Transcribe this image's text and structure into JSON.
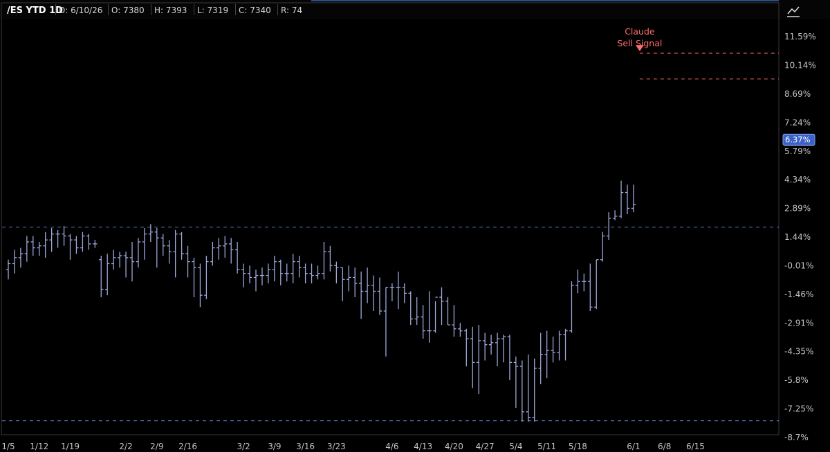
{
  "header": {
    "title": "/ES YTD 1D",
    "date": "D: 6/10/26",
    "open": "O: 7380",
    "high": "H: 7393",
    "low": "L: 7319",
    "close": "C: 7340",
    "range": "R: 74"
  },
  "toolbar": {
    "tool_icon": "drawing-tool-icon"
  },
  "colors": {
    "background": "#000000",
    "bar": "#9fa8da",
    "support_line": "#5b7fc4",
    "signal": "#ff6b6b",
    "last_price_badge": "#3b62c9",
    "border": "#3a3a3a"
  },
  "chart_data": {
    "type": "ohlc",
    "y_axis_unit": "%",
    "ylim": [
      -8.7,
      13.0
    ],
    "y_ticks": [
      "11.59%",
      "10.14%",
      "8.69%",
      "7.24%",
      "5.79%",
      "4.34%",
      "2.89%",
      "1.44%",
      "-0.01%",
      "-1.46%",
      "-2.91%",
      "-4.35%",
      "-5.8%",
      "-7.25%",
      "-8.7%"
    ],
    "y_tick_values": [
      11.59,
      10.14,
      8.69,
      7.24,
      5.79,
      4.34,
      2.89,
      1.44,
      -0.01,
      -1.46,
      -2.91,
      -4.35,
      -5.8,
      -7.25,
      -8.7
    ],
    "x_ticks": [
      "1/5",
      "1/12",
      "1/19",
      "2/2",
      "2/9",
      "2/16",
      "3/2",
      "3/9",
      "3/16",
      "3/23",
      "4/6",
      "4/13",
      "4/20",
      "4/27",
      "5/4",
      "5/11",
      "5/18",
      "6/1",
      "6/8",
      "6/15"
    ],
    "x_tick_index": [
      0,
      5,
      10,
      19,
      24,
      29,
      38,
      43,
      48,
      53,
      62,
      67,
      72,
      77,
      82,
      87,
      92,
      101,
      106,
      111
    ],
    "last_price_label": "6.37%",
    "last_price_value": 6.37,
    "horizontal_levels": [
      {
        "value": 1.95,
        "style": "dashed",
        "color": "#5b7fc4",
        "span": "full"
      },
      {
        "value": -7.85,
        "style": "dashed",
        "color": "#5b7fc4",
        "span": "full"
      },
      {
        "value": 10.75,
        "style": "dashed",
        "color": "#ff6b6b",
        "span": "from-signal"
      },
      {
        "value": 9.45,
        "style": "dashed",
        "color": "#ff6b6b",
        "span": "from-signal"
      }
    ],
    "annotation": {
      "text_line1": "Claude",
      "text_line2": "Sell Signal",
      "bar_index": 102,
      "value": 10.85
    },
    "bars": [
      {
        "o": -0.2,
        "h": 0.3,
        "l": -0.7,
        "c": 0.1
      },
      {
        "o": 0.1,
        "h": 0.8,
        "l": -0.4,
        "c": 0.4
      },
      {
        "o": 0.4,
        "h": 0.9,
        "l": -0.1,
        "c": 0.6
      },
      {
        "o": 0.6,
        "h": 1.5,
        "l": 0.2,
        "c": 1.2
      },
      {
        "o": 1.2,
        "h": 1.5,
        "l": 0.5,
        "c": 0.9
      },
      {
        "o": 0.9,
        "h": 1.2,
        "l": 0.5,
        "c": 1.0
      },
      {
        "o": 1.0,
        "h": 1.7,
        "l": 0.4,
        "c": 1.3
      },
      {
        "o": 1.3,
        "h": 1.9,
        "l": 0.7,
        "c": 1.6
      },
      {
        "o": 1.6,
        "h": 1.8,
        "l": 0.9,
        "c": 1.6
      },
      {
        "o": 1.6,
        "h": 2.0,
        "l": 1.0,
        "c": 1.5
      },
      {
        "o": 1.5,
        "h": 1.6,
        "l": 0.3,
        "c": 1.3
      },
      {
        "o": 1.3,
        "h": 1.5,
        "l": 0.6,
        "c": 0.9
      },
      {
        "o": 0.9,
        "h": 1.7,
        "l": 0.7,
        "c": 1.5
      },
      {
        "o": 1.5,
        "h": 1.6,
        "l": 0.8,
        "c": 1.1
      },
      {
        "o": 1.1,
        "h": 1.3,
        "l": 0.9,
        "c": 1.1
      },
      {
        "o": 0.3,
        "h": 0.5,
        "l": -1.6,
        "c": -1.2
      },
      {
        "o": -1.2,
        "h": 0.6,
        "l": -1.5,
        "c": 0.1
      },
      {
        "o": 0.1,
        "h": 0.8,
        "l": -0.2,
        "c": 0.4
      },
      {
        "o": 0.4,
        "h": 0.7,
        "l": -0.1,
        "c": 0.5
      },
      {
        "o": 0.5,
        "h": 0.7,
        "l": -0.6,
        "c": 0.4
      },
      {
        "o": 0.4,
        "h": 1.2,
        "l": -0.8,
        "c": 0.2
      },
      {
        "o": 0.2,
        "h": 1.4,
        "l": -0.1,
        "c": 1.2
      },
      {
        "o": 1.2,
        "h": 1.9,
        "l": 0.3,
        "c": 1.6
      },
      {
        "o": 1.6,
        "h": 2.1,
        "l": 1.2,
        "c": 1.7
      },
      {
        "o": 1.7,
        "h": 1.9,
        "l": -0.1,
        "c": 1.4
      },
      {
        "o": 1.4,
        "h": 1.6,
        "l": 0.5,
        "c": 1.0
      },
      {
        "o": 1.0,
        "h": 1.3,
        "l": 0.1,
        "c": 0.7
      },
      {
        "o": 0.7,
        "h": 1.8,
        "l": -0.6,
        "c": 1.6
      },
      {
        "o": 1.6,
        "h": 1.7,
        "l": 0.3,
        "c": 0.6
      },
      {
        "o": 0.6,
        "h": 1.0,
        "l": -0.6,
        "c": 0.2
      },
      {
        "o": 0.2,
        "h": 0.4,
        "l": -1.6,
        "c": -0.1
      },
      {
        "o": -0.1,
        "h": 0.1,
        "l": -2.1,
        "c": -1.5
      },
      {
        "o": -1.5,
        "h": 0.5,
        "l": -1.7,
        "c": 0.2
      },
      {
        "o": 0.2,
        "h": 1.2,
        "l": 0.0,
        "c": 0.9
      },
      {
        "o": 0.9,
        "h": 1.4,
        "l": 0.3,
        "c": 1.0
      },
      {
        "o": 1.0,
        "h": 1.5,
        "l": 0.4,
        "c": 1.1
      },
      {
        "o": 1.1,
        "h": 1.4,
        "l": 0.1,
        "c": 0.8
      },
      {
        "o": 0.8,
        "h": 1.2,
        "l": -0.4,
        "c": -0.2
      },
      {
        "o": -0.2,
        "h": 0.1,
        "l": -1.1,
        "c": -0.4
      },
      {
        "o": -0.4,
        "h": 0.0,
        "l": -0.9,
        "c": -0.6
      },
      {
        "o": -0.6,
        "h": -0.2,
        "l": -1.3,
        "c": -0.5
      },
      {
        "o": -0.5,
        "h": -0.1,
        "l": -1.0,
        "c": -0.5
      },
      {
        "o": -0.5,
        "h": 0.1,
        "l": -0.9,
        "c": -0.2
      },
      {
        "o": -0.2,
        "h": 0.5,
        "l": -0.8,
        "c": 0.2
      },
      {
        "o": 0.2,
        "h": 0.3,
        "l": -1.0,
        "c": -0.4
      },
      {
        "o": -0.4,
        "h": 0.1,
        "l": -0.8,
        "c": -0.4
      },
      {
        "o": -0.4,
        "h": 0.6,
        "l": -0.9,
        "c": 0.2
      },
      {
        "o": 0.2,
        "h": 0.5,
        "l": -0.6,
        "c": -0.1
      },
      {
        "o": -0.1,
        "h": 0.1,
        "l": -0.9,
        "c": -0.4
      },
      {
        "o": -0.4,
        "h": 0.1,
        "l": -0.9,
        "c": -0.5
      },
      {
        "o": -0.5,
        "h": 0.0,
        "l": -0.7,
        "c": -0.4
      },
      {
        "o": -0.4,
        "h": 1.2,
        "l": -0.7,
        "c": 0.7
      },
      {
        "o": 0.7,
        "h": 1.0,
        "l": -0.3,
        "c": 0.0
      },
      {
        "o": 0.0,
        "h": 0.2,
        "l": -0.9,
        "c": -0.1
      },
      {
        "o": -0.1,
        "h": -0.1,
        "l": -1.8,
        "c": -0.7
      },
      {
        "o": -0.7,
        "h": 0.0,
        "l": -1.3,
        "c": -0.6
      },
      {
        "o": -0.6,
        "h": -0.1,
        "l": -1.6,
        "c": -0.9
      },
      {
        "o": -0.9,
        "h": -0.3,
        "l": -2.7,
        "c": -1.3
      },
      {
        "o": -1.3,
        "h": -0.1,
        "l": -1.9,
        "c": -1.0
      },
      {
        "o": -1.0,
        "h": -0.5,
        "l": -2.3,
        "c": -1.3
      },
      {
        "o": -1.3,
        "h": -0.6,
        "l": -2.5,
        "c": -2.3
      },
      {
        "o": -2.3,
        "h": -1.1,
        "l": -4.6,
        "c": -1.1
      },
      {
        "o": -1.1,
        "h": -0.9,
        "l": -1.8,
        "c": -1.1
      },
      {
        "o": -1.1,
        "h": -0.3,
        "l": -2.2,
        "c": -1.1
      },
      {
        "o": -1.1,
        "h": -0.9,
        "l": -1.9,
        "c": -1.4
      },
      {
        "o": -1.4,
        "h": -1.3,
        "l": -3.0,
        "c": -2.7
      },
      {
        "o": -2.7,
        "h": -1.6,
        "l": -3.0,
        "c": -2.6
      },
      {
        "o": -2.6,
        "h": -2.0,
        "l": -3.7,
        "c": -3.3
      },
      {
        "o": -3.3,
        "h": -1.3,
        "l": -3.9,
        "c": -3.3
      },
      {
        "o": -3.3,
        "h": -1.8,
        "l": -3.4,
        "c": -1.6
      },
      {
        "o": -1.6,
        "h": -1.1,
        "l": -3.0,
        "c": -1.8
      },
      {
        "o": -1.8,
        "h": -1.6,
        "l": -3.0,
        "c": -3.0
      },
      {
        "o": -3.0,
        "h": -2.0,
        "l": -3.6,
        "c": -3.2
      },
      {
        "o": -3.2,
        "h": -2.9,
        "l": -3.6,
        "c": -3.3
      },
      {
        "o": -3.3,
        "h": -3.2,
        "l": -5.1,
        "c": -3.7
      },
      {
        "o": -3.7,
        "h": -3.1,
        "l": -6.2,
        "c": -4.9
      },
      {
        "o": -4.9,
        "h": -3.0,
        "l": -6.5,
        "c": -3.8
      },
      {
        "o": -3.8,
        "h": -3.4,
        "l": -4.8,
        "c": -4.0
      },
      {
        "o": -4.0,
        "h": -3.5,
        "l": -4.5,
        "c": -3.9
      },
      {
        "o": -3.9,
        "h": -3.4,
        "l": -5.1,
        "c": -3.7
      },
      {
        "o": -3.7,
        "h": -3.5,
        "l": -4.9,
        "c": -3.6
      },
      {
        "o": -3.6,
        "h": -3.5,
        "l": -5.8,
        "c": -4.9
      },
      {
        "o": -4.9,
        "h": -4.6,
        "l": -7.2,
        "c": -5.1
      },
      {
        "o": -5.1,
        "h": -4.8,
        "l": -7.9,
        "c": -7.4
      },
      {
        "o": -7.4,
        "h": -4.5,
        "l": -7.9,
        "c": -7.7
      },
      {
        "o": -7.7,
        "h": -4.7,
        "l": -7.9,
        "c": -5.2
      },
      {
        "o": -5.2,
        "h": -3.4,
        "l": -6.0,
        "c": -4.5
      },
      {
        "o": -4.5,
        "h": -3.3,
        "l": -5.7,
        "c": -4.3
      },
      {
        "o": -4.3,
        "h": -3.6,
        "l": -4.9,
        "c": -4.4
      },
      {
        "o": -4.4,
        "h": -3.3,
        "l": -4.8,
        "c": -3.5
      },
      {
        "o": -3.5,
        "h": -3.2,
        "l": -4.8,
        "c": -3.3
      },
      {
        "o": -3.3,
        "h": -0.8,
        "l": -3.4,
        "c": -1.0
      },
      {
        "o": -1.0,
        "h": -0.2,
        "l": -1.4,
        "c": -0.8
      },
      {
        "o": -0.8,
        "h": -0.4,
        "l": -1.3,
        "c": -0.8
      },
      {
        "o": -0.8,
        "h": 0.1,
        "l": -2.3,
        "c": -2.1
      },
      {
        "o": -2.1,
        "h": 0.3,
        "l": -2.2,
        "c": 0.3
      },
      {
        "o": 0.3,
        "h": 1.7,
        "l": 0.2,
        "c": 1.5
      },
      {
        "o": 1.5,
        "h": 2.7,
        "l": 1.3,
        "c": 2.4
      },
      {
        "o": 2.4,
        "h": 2.8,
        "l": 2.3,
        "c": 2.5
      },
      {
        "o": 2.5,
        "h": 4.3,
        "l": 2.4,
        "c": 3.7
      },
      {
        "o": 3.7,
        "h": 4.1,
        "l": 2.6,
        "c": 2.9
      },
      {
        "o": 2.9,
        "h": 4.1,
        "l": 2.7,
        "c": 3.1
      }
    ]
  }
}
